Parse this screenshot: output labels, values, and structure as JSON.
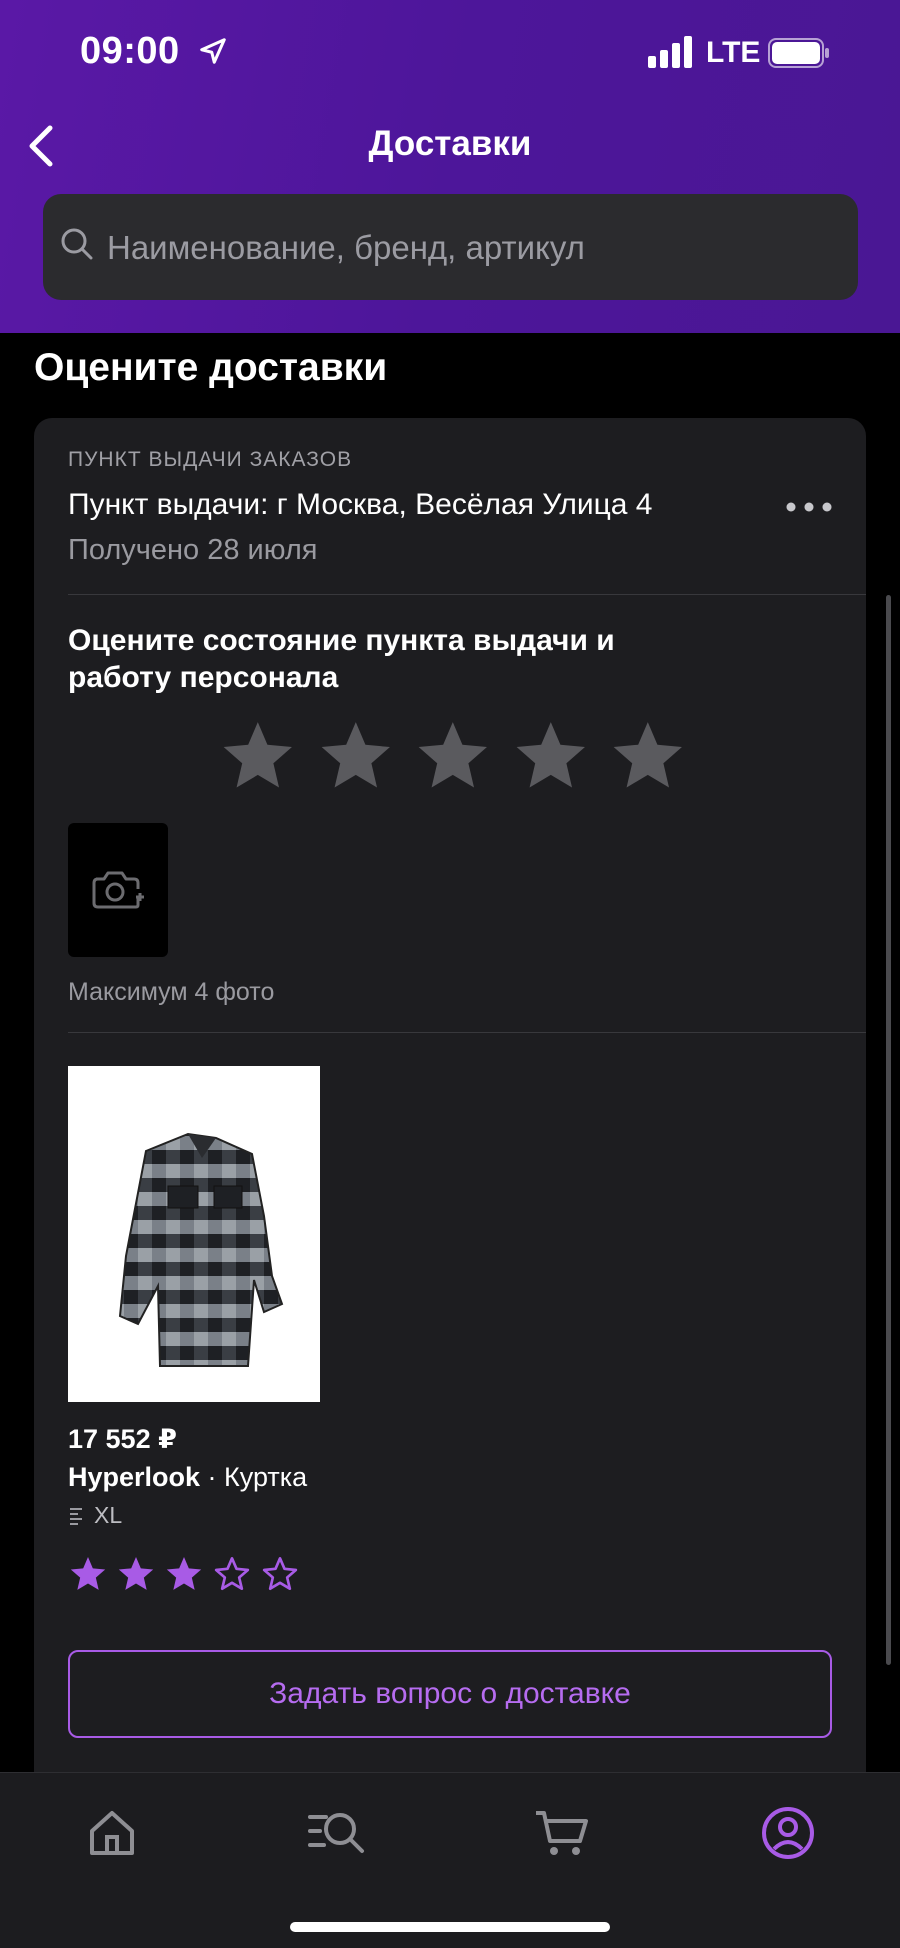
{
  "status_bar": {
    "time": "09:00",
    "network": "LTE"
  },
  "header": {
    "title": "Доставки"
  },
  "search": {
    "placeholder": "Наименование, бренд, артикул"
  },
  "section": {
    "title": "Оцените доставки"
  },
  "pickup": {
    "label": "ПУНКТ ВЫДАЧИ ЗАКАЗОВ",
    "address": "Пункт выдачи: г Москва, Весёлая Улица 4",
    "received": "Получено 28 июля"
  },
  "rating": {
    "title": "Оцените состояние пункта выдачи и работу персонала",
    "stars_total": 5,
    "stars_selected": 0
  },
  "photos": {
    "max_label": "Максимум 4 фото"
  },
  "product": {
    "price": "17 552 ₽",
    "brand": "Hyperlook",
    "separator": " · ",
    "name": "Куртка",
    "size": "XL",
    "rating": 3,
    "rating_max": 5
  },
  "ask_button": {
    "label": "Задать вопрос о доставке"
  },
  "tabbar": {
    "items": [
      {
        "icon": "home-icon"
      },
      {
        "icon": "catalog-search-icon"
      },
      {
        "icon": "cart-icon"
      },
      {
        "icon": "profile-icon",
        "active": true
      }
    ]
  },
  "colors": {
    "header": "#5a18a6",
    "accent": "#b66cf0",
    "card": "#1d1d20",
    "star_inactive": "#5a5a5e",
    "star_active": "#a85be6"
  }
}
